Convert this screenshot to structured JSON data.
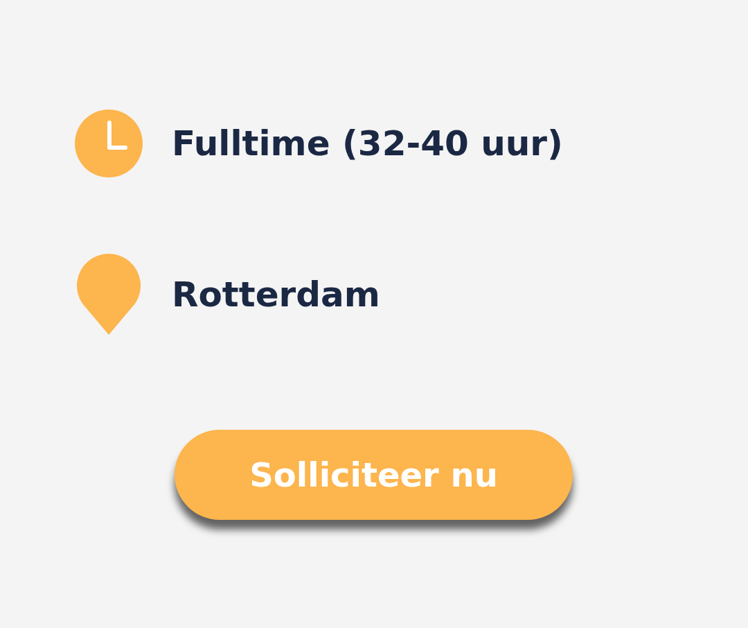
{
  "details": [
    {
      "kind": "hours",
      "text": "Fulltime (32-40 uur)"
    },
    {
      "kind": "location",
      "text": "Rotterdam"
    }
  ],
  "apply_button": {
    "label": "Solliciteer nu"
  }
}
